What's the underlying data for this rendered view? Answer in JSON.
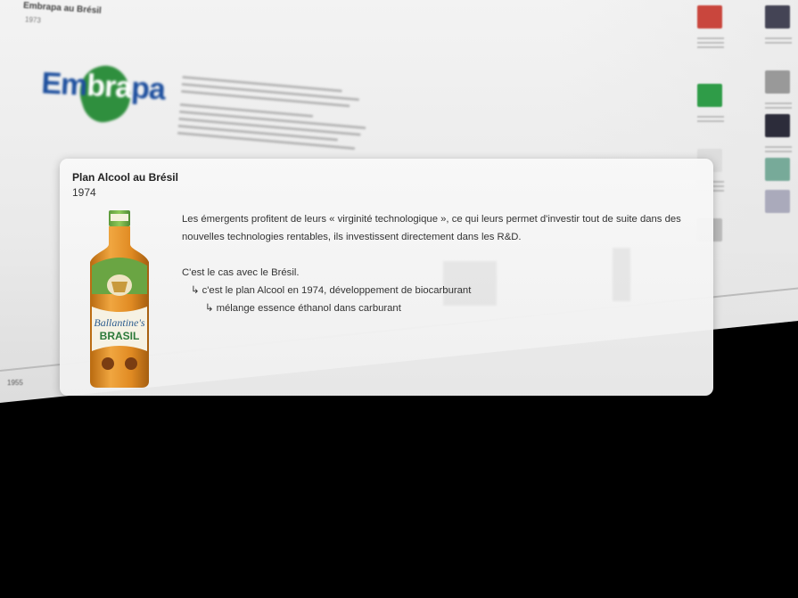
{
  "background": {
    "page_title": "Embrapa au Brésil",
    "page_year": "1973",
    "logo_text_part1": "Em",
    "logo_text_part2": "bra",
    "logo_text_part3": "pa",
    "axis_year": "1955"
  },
  "popup": {
    "title": "Plan Alcool au Brésil",
    "year": "1974",
    "image_label": "Ballantine's BRASIL",
    "paragraph1": "Les émergents profitent de leurs « virginité technologique », ce qui leurs permet d'investir tout de suite dans des nouvelles technologies rentables, ils investissent directement dans les R&D.",
    "paragraph2": "C'est le cas avec le Brésil.",
    "bullet1": "↳ c'est le plan Alcool en 1974, développement de biocarburant",
    "bullet2": "↳ mélange essence éthanol dans carburant"
  },
  "colors": {
    "background": "#000000",
    "card": "#f3f3f3",
    "embrapa_blue": "#1d4f9e",
    "embrapa_green": "#2f8f3e",
    "bottle_amber": "#d98a1c",
    "bottle_green": "#3f8a3a"
  }
}
